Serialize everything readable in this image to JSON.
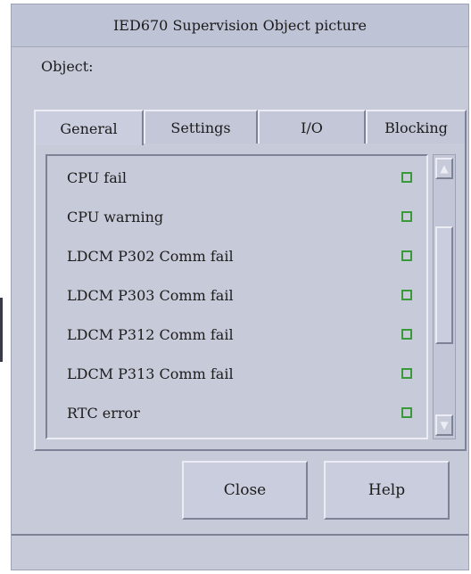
{
  "window": {
    "title": "IED670 Supervision Object picture"
  },
  "object_label": "Object:",
  "tabs": [
    {
      "label": "General",
      "active": true
    },
    {
      "label": "Settings",
      "active": false
    },
    {
      "label": "I/O",
      "active": false
    },
    {
      "label": "Blocking",
      "active": false
    }
  ],
  "signals": [
    {
      "label": "CPU fail",
      "state": "off"
    },
    {
      "label": "CPU warning",
      "state": "off"
    },
    {
      "label": "LDCM P302 Comm fail",
      "state": "off"
    },
    {
      "label": "LDCM P303 Comm fail",
      "state": "off"
    },
    {
      "label": "LDCM P312 Comm fail",
      "state": "off"
    },
    {
      "label": "LDCM P313 Comm fail",
      "state": "off"
    },
    {
      "label": "RTC error",
      "state": "off"
    }
  ],
  "scrollbar": {
    "up_icon": "scroll-up-arrow",
    "down_icon": "scroll-down-arrow"
  },
  "buttons": {
    "close_label": "Close",
    "help_label": "Help"
  },
  "colors": {
    "panel": "#c6cad9",
    "indicator": "#3a9a3a"
  }
}
